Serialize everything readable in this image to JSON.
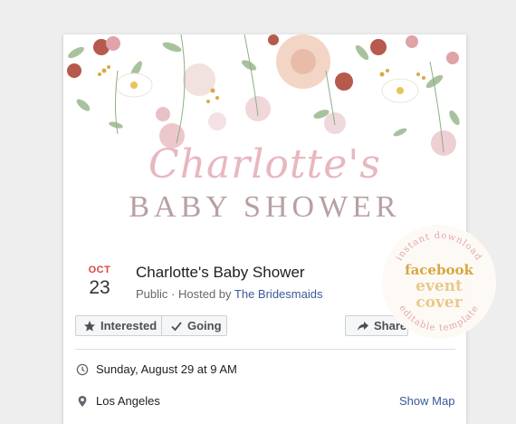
{
  "cover": {
    "script_title": "Charlotte's",
    "serif_title": "BABY SHOWER"
  },
  "event": {
    "month": "OCT",
    "day": "23",
    "title": "Charlotte's Baby Shower",
    "privacy": "Public",
    "hosted_prefix": "· Hosted by",
    "host": "The Bridesmaids"
  },
  "actions": {
    "interested": "Interested",
    "going": "Going",
    "share": "Share"
  },
  "details": {
    "when": "Sunday, August 29 at 9 AM",
    "where": "Los Angeles",
    "map_link": "Show Map"
  },
  "badge": {
    "top_text": "instant download",
    "line1": "facebook",
    "line2": "event",
    "line3": "cover",
    "bottom_text": "editable template"
  },
  "colors": {
    "date_month": "#d8453e",
    "link": "#385898",
    "badge_gold": "#d8a73f",
    "badge_pink": "#e3a6ad"
  },
  "icons": {
    "interested": "star-icon",
    "going": "check-icon",
    "share": "share-arrow-icon",
    "when": "clock-icon",
    "where": "location-pin-icon"
  }
}
